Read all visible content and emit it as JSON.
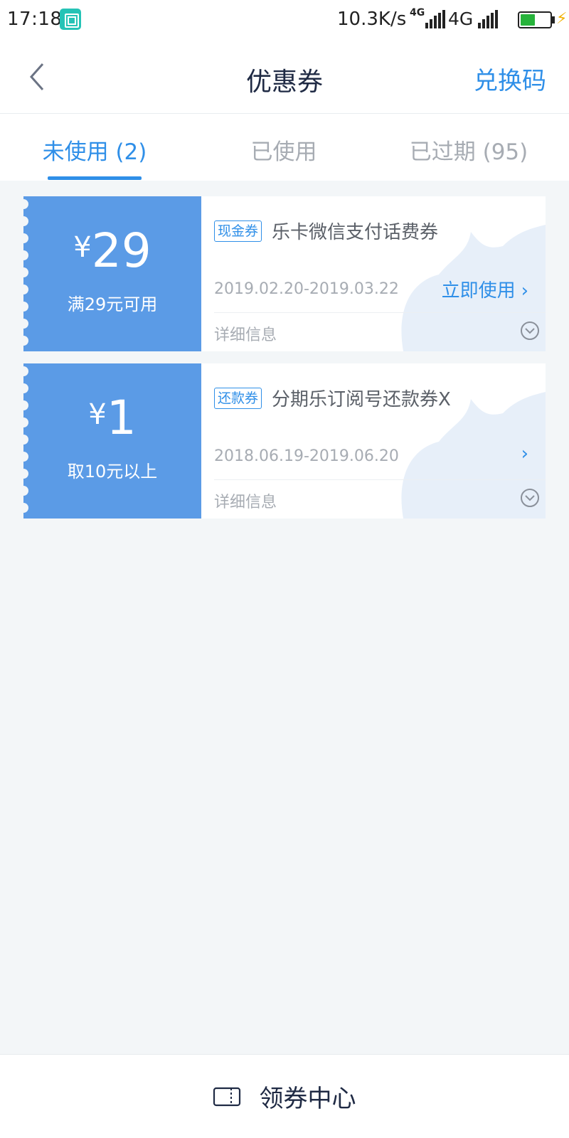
{
  "status_bar": {
    "time": "17:18",
    "net_speed": "10.3K/s",
    "network_1": "4G",
    "network_2": "4G"
  },
  "nav": {
    "title": "优惠券",
    "action": "兑换码"
  },
  "tabs": [
    {
      "label": "未使用 (2)",
      "active": true
    },
    {
      "label": "已使用",
      "active": false
    },
    {
      "label": "已过期 (95)",
      "active": false
    }
  ],
  "coupons": [
    {
      "currency": "¥",
      "amount": "29",
      "condition": "满29元可用",
      "tag": "现金券",
      "name": "乐卡微信支付话费券",
      "validity": "2019.02.20-2019.03.22",
      "action": "立即使用",
      "details": "详细信息"
    },
    {
      "currency": "¥",
      "amount": "1",
      "condition": "取10元以上",
      "tag": "还款券",
      "name": "分期乐订阅号还款券X",
      "validity": "2018.06.19-2019.06.20",
      "action": "",
      "details": "详细信息"
    }
  ],
  "footer": {
    "label": "领券中心"
  },
  "colors": {
    "accent": "#2f8fe8",
    "coupon_left": "#5b9be6",
    "background": "#f3f6f8"
  }
}
